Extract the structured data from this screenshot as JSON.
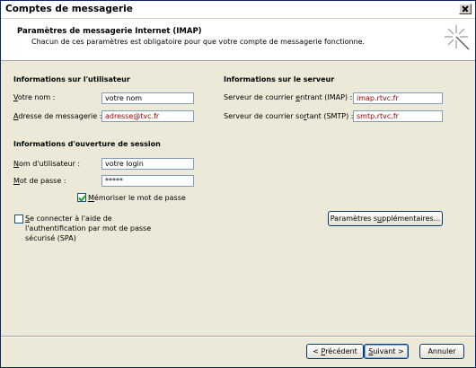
{
  "window": {
    "title": "Comptes de messagerie"
  },
  "header": {
    "title": "Paramètres de messagerie Internet (IMAP)",
    "subtitle": "Chacun de ces paramètres est obligatoire pour que votre compte de messagerie fonctionne."
  },
  "user_info": {
    "section_title": "Informations sur l'utilisateur",
    "name_label_pre": "",
    "name_label_u": "V",
    "name_label_post": "otre nom :",
    "name_value": "votre nom",
    "email_label_pre": "",
    "email_label_u": "A",
    "email_label_post": "dresse de messagerie :",
    "email_value": "adresse@tvc.fr"
  },
  "server_info": {
    "section_title": "Informations sur le serveur",
    "incoming_label_pre": "Serveur de courrier ",
    "incoming_label_u": "e",
    "incoming_label_post": "ntrant (IMAP) :",
    "incoming_value": "imap.rtvc.fr",
    "outgoing_label_pre": "Serveur de courrier so",
    "outgoing_label_u": "r",
    "outgoing_label_post": "tant (SMTP) :",
    "outgoing_value": "smtp.rtvc.fr"
  },
  "login_info": {
    "section_title": "Informations d'ouverture de session",
    "username_label_pre": "",
    "username_label_u": "N",
    "username_label_post": "om d'utilisateur :",
    "username_value": "votre login",
    "password_label_pre": "",
    "password_label_u": "M",
    "password_label_post": "ot de passe :",
    "password_value": "*****",
    "remember_label_pre": "",
    "remember_label_u": "M",
    "remember_label_post": "émoriser le mot de passe",
    "remember_checked": true
  },
  "spa": {
    "checked": false,
    "line1_pre": "",
    "line1_u": "S",
    "line1_post": "e connecter à l'aide de",
    "line2": "l'authentification par mot de passe",
    "line3": "sécurisé (SPA)"
  },
  "buttons": {
    "more_settings_pre": "Paramètres s",
    "more_settings_u": "u",
    "more_settings_post": "pplémentaires...",
    "back_pre": "< ",
    "back_u": "P",
    "back_post": "récédent",
    "next_pre": "",
    "next_u": "S",
    "next_post": "uivant >",
    "cancel": "Annuler"
  },
  "icons": {
    "wizard": "wizard-sparkle-icon",
    "close": "close-icon"
  }
}
